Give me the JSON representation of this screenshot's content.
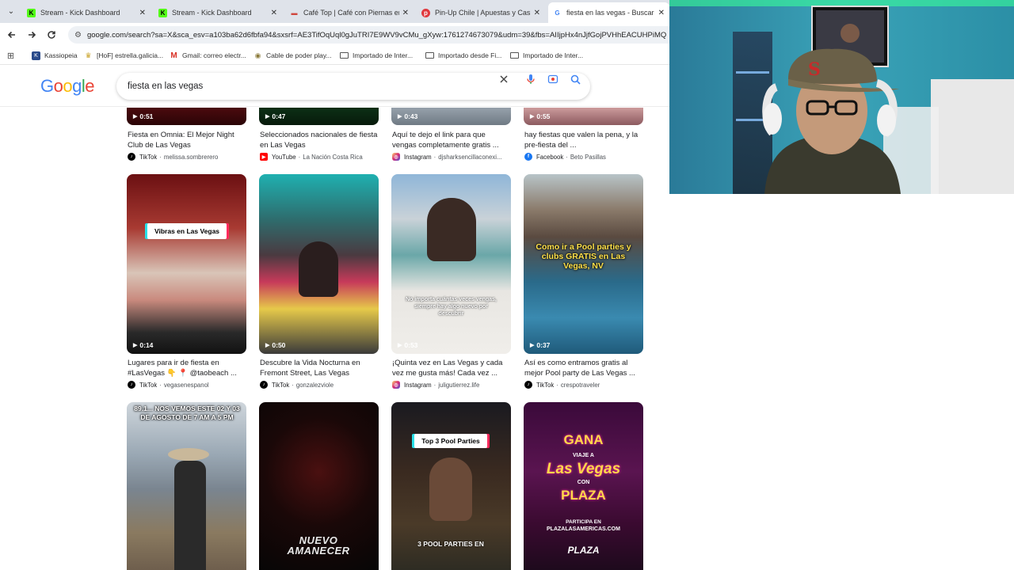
{
  "browser": {
    "tabs": [
      {
        "title": "Stream - Kick Dashboard",
        "icon": "kick-icon",
        "color": "#53fc18"
      },
      {
        "title": "Stream - Kick Dashboard",
        "icon": "kick-icon",
        "color": "#53fc18"
      },
      {
        "title": "Café Top | Café con Piernas en ...",
        "icon": "cafe-top-icon",
        "color": "#d0463c"
      },
      {
        "title": "Pin-Up Chile | Apuestas y Casin...",
        "icon": "pinup-icon",
        "color": "#e0393e"
      },
      {
        "title": "fiesta en las vegas - Buscar con ...",
        "icon": "google-icon",
        "color": "#4285f4"
      }
    ],
    "url": "google.com/search?sa=X&sca_esv=a103ba62d6fbfa94&sxsrf=AE3TifOqUql0gJuTRI7E9WV9vCMu_gXyw:1761274673079&udm=39&fbs=AIIjpHx4nJjfGojPVHhEACUHPiMQ",
    "bookmarks": [
      {
        "label": "",
        "icon": "apps-grid-icon"
      },
      {
        "label": "Kassiopeia",
        "icon": "kassiopeia-icon"
      },
      {
        "label": "[HoF] estrella.galicia...",
        "icon": "hof-icon"
      },
      {
        "label": "Gmail: correo electr...",
        "icon": "gmail-icon"
      },
      {
        "label": "Cable de poder play...",
        "icon": "cable-icon"
      },
      {
        "label": "Importado de Inter...",
        "icon": "folder-icon"
      },
      {
        "label": "Importado desde Fi...",
        "icon": "folder-icon"
      },
      {
        "label": "Importado de Inter...",
        "icon": "folder-icon"
      }
    ]
  },
  "google": {
    "logo": "Google",
    "query": "fiesta en las vegas"
  },
  "results": {
    "row1": [
      {
        "duration": "0:51",
        "title": "Fiesta en Omnia: El Mejor Night Club de Las Vegas",
        "platform": "TikTok",
        "channel": "melissa.sombrerero"
      },
      {
        "duration": "0:47",
        "title": "Seleccionados nacionales de fiesta en Las Vegas",
        "platform": "YouTube",
        "channel": "La Nación Costa Rica"
      },
      {
        "duration": "0:43",
        "title": "Aquí te dejo el link para que vengas completamente gratis ...",
        "platform": "Instagram",
        "channel": "djsharksencillaconexi..."
      },
      {
        "duration": "0:55",
        "title": "hay fiestas que valen la pena, y la pre-fiesta del ...",
        "platform": "Facebook",
        "channel": "Beto Pasillas"
      }
    ],
    "row2": [
      {
        "duration": "0:14",
        "title": "Lugares para ir de fiesta en #LasVegas 👇 📍 @taobeach ...",
        "platform": "TikTok",
        "channel": "vegasenespanol",
        "overlay": "Vibras en Las Vegas"
      },
      {
        "duration": "0:50",
        "title": "Descubre la Vida Nocturna en Fremont Street, Las Vegas",
        "platform": "TikTok",
        "channel": "gonzalezviole",
        "overlay": ""
      },
      {
        "duration": "0:53",
        "title": "¡Quinta vez en Las Vegas y cada vez me gusta más! Cada vez ...",
        "platform": "Instagram",
        "channel": "juligutierrez.life",
        "overlay": "No importa cuántas veces vengas, siempre hay algo nuevo por descubrir"
      },
      {
        "duration": "0:37",
        "title": "Así es como entramos gratis al mejor Pool party de Las Vegas ...",
        "platform": "TikTok",
        "channel": "crespotraveler",
        "overlay": "Como ir a Pool parties y clubs GRATIS en Las Vegas, NV"
      }
    ],
    "row3": [
      {
        "overlay": "89.1... NOS VEMOS ESTE 02 Y 03 DE AGOSTO DE 7 AM A 5 PM"
      },
      {
        "overlay": "NUEVO AMANECER"
      },
      {
        "overlay": "Top 3 Pool Parties",
        "overlay2": "3 POOL PARTIES EN"
      },
      {
        "overlay": "GANA",
        "overlay2": "VIAJE A",
        "overlay3": "Las Vegas",
        "overlay4": "CON",
        "overlay5": "PLAZA",
        "overlay6": "PARTICIPA EN",
        "overlay7": "PLAZALASAMERICAS.COM",
        "overlay8": "PLAZA"
      }
    ]
  }
}
